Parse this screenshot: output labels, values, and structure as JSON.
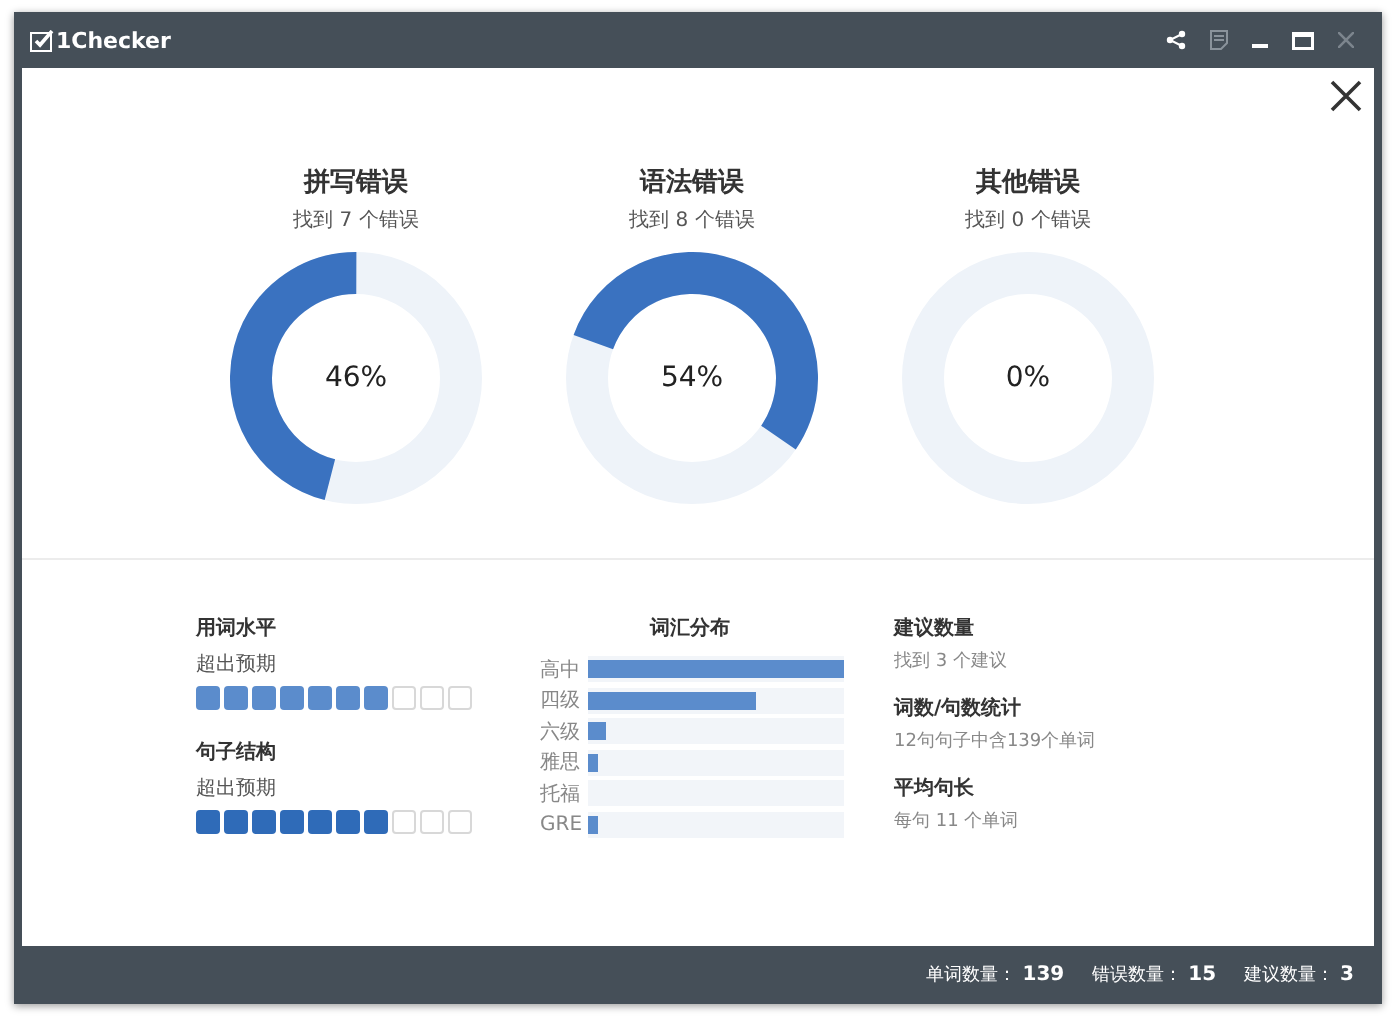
{
  "window": {
    "title": "1Checker"
  },
  "categories": [
    {
      "title": "拼写错误",
      "subtitle": "找到 7 个错误",
      "level": 0.46,
      "reading": "46%"
    },
    {
      "title": "语法错误",
      "subtitle": "找到 8 个错误",
      "level": 0.54,
      "reading": "54%"
    },
    {
      "title": "其他错误",
      "subtitle": "找到 0 个错误",
      "level": 0,
      "reading": "0%"
    }
  ],
  "ratings": [
    {
      "label": "用词水平",
      "value": "超出预期",
      "level": 0.7
    },
    {
      "label": "句子结构",
      "value": "超出预期",
      "level": 0.7
    }
  ],
  "vocabulary": {
    "title": "词汇分布",
    "rows": [
      {
        "label": "高中",
        "level": 1
      },
      {
        "label": "四级",
        "level": 0.66
      },
      {
        "label": "六级",
        "level": 0.07
      },
      {
        "label": "雅思",
        "level": 0.04
      },
      {
        "label": "托福",
        "level": 0
      },
      {
        "label": "GRE",
        "level": 0.04
      }
    ]
  },
  "stats": [
    {
      "label": "建议数量",
      "value": "找到 3 个建议"
    },
    {
      "label": "词数/句数统计",
      "value": "12句句子中含139个单词"
    },
    {
      "label": "平均句长",
      "value": "每句 11 个单词"
    }
  ],
  "status_bar": [
    {
      "label": "单词数量：",
      "value": "139"
    },
    {
      "label": "错误数量：",
      "value": "15"
    },
    {
      "label": "建议数量：",
      "value": "3"
    }
  ]
}
